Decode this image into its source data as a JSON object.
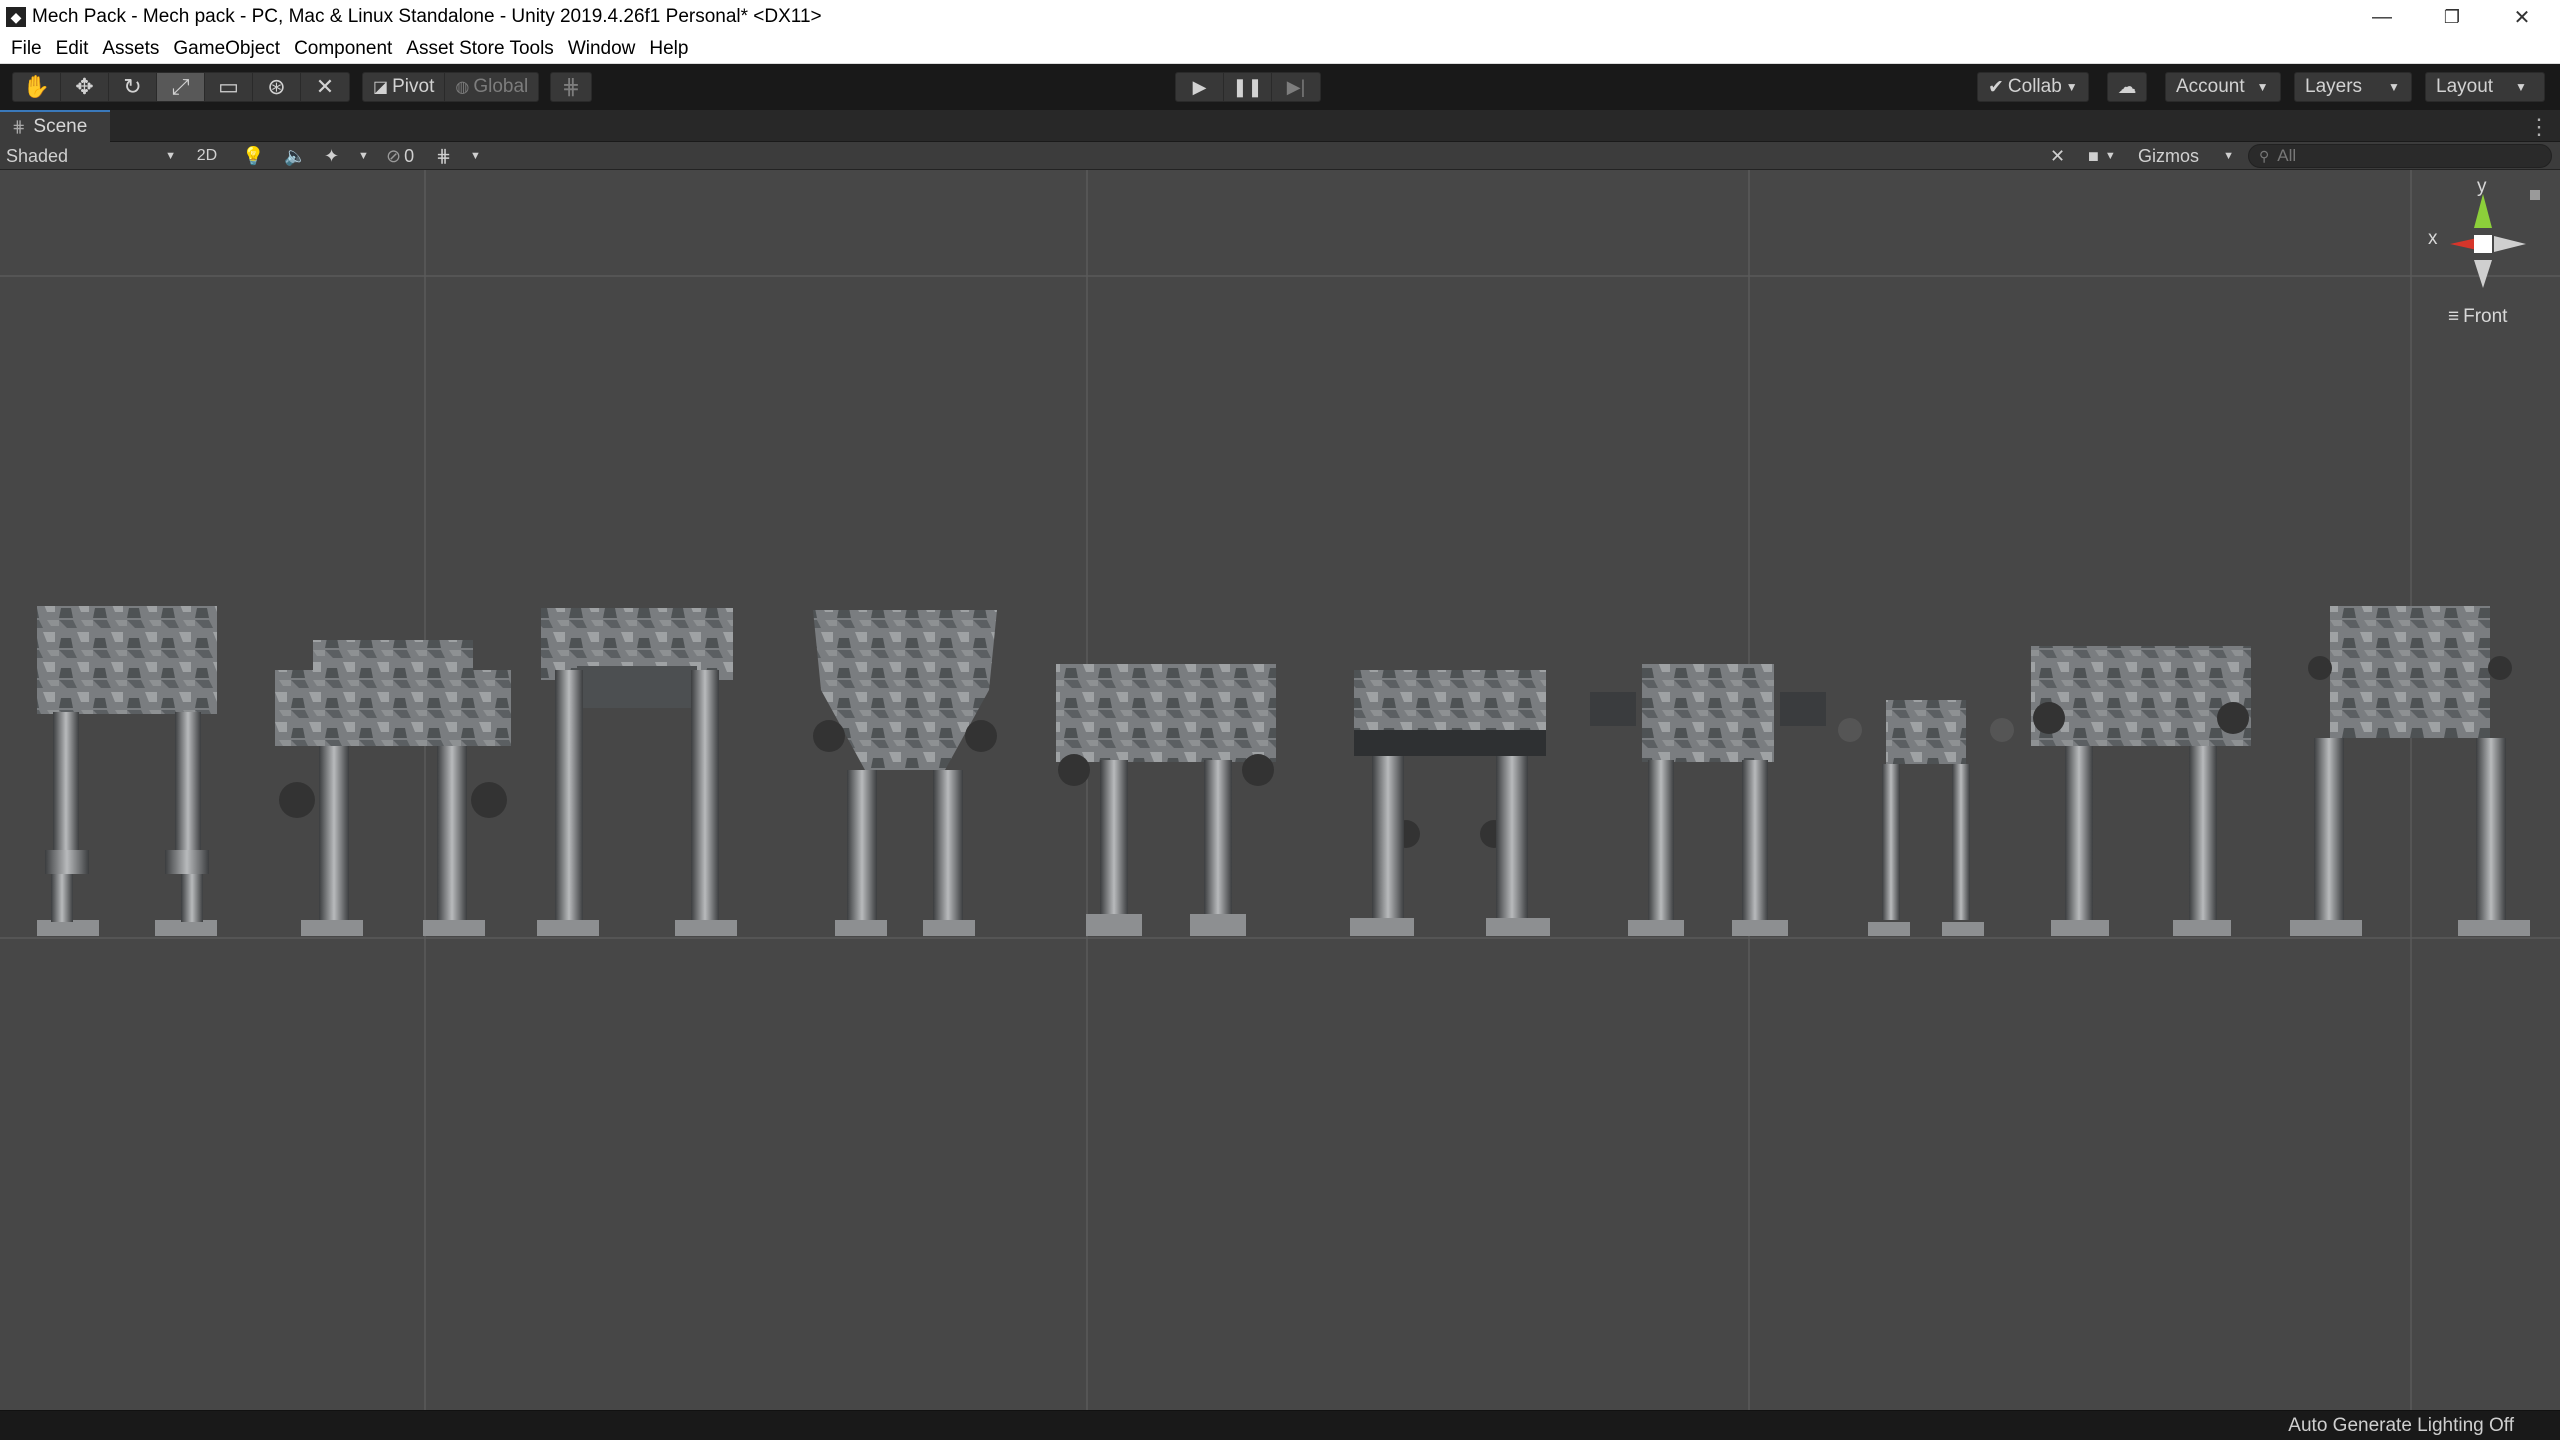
{
  "window": {
    "title": "Mech Pack - Mech pack - PC, Mac & Linux Standalone - Unity 2019.4.26f1 Personal* <DX11>",
    "minimize": "—",
    "restore": "❐",
    "close": "✕"
  },
  "menu": [
    "File",
    "Edit",
    "Assets",
    "GameObject",
    "Component",
    "Asset Store Tools",
    "Window",
    "Help"
  ],
  "toolbar": {
    "pivot_label": "Pivot",
    "global_label": "Global",
    "collab_label": "Collab",
    "account_label": "Account",
    "layers_label": "Layers",
    "layout_label": "Layout"
  },
  "scene_tab": {
    "label": "Scene"
  },
  "scene_bar": {
    "shading_mode": "Shaded",
    "mode_2d": "2D",
    "hidden_count": "0",
    "gizmos_label": "Gizmos",
    "search_placeholder": "All"
  },
  "scene_gizmo": {
    "y_label": "y",
    "x_label": "x",
    "view_label": "Front"
  },
  "status": {
    "text": "Auto Generate Lighting Off"
  },
  "colors": {
    "axis_x": "#d6352a",
    "axis_y": "#8ccf3a",
    "accent_tab": "#3a79bb"
  }
}
